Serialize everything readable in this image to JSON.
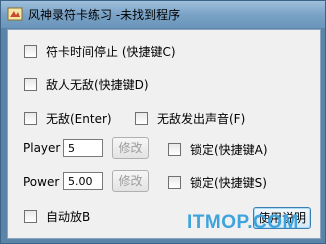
{
  "window": {
    "title": "风神录符卡练习 -未找到程序"
  },
  "checkboxes": {
    "freeze_time": "符卡时间停止 (快捷键C)",
    "enemy_invincible": "敌人无敌(快捷键D)",
    "invincible": "无敌(Enter)",
    "invincible_sound": "无敌发出声音(F)",
    "lock_player": "锁定(快捷键A)",
    "lock_power": "锁定(快捷键S)",
    "auto_bomb": "自动放B"
  },
  "player": {
    "label": "Player",
    "value": "5",
    "modify_label": "修改"
  },
  "power": {
    "label": "Power",
    "value": "5.00",
    "modify_label": "修改"
  },
  "buttons": {
    "help_label": "使用说明"
  },
  "watermark": {
    "text": "ITMOP.COM"
  }
}
